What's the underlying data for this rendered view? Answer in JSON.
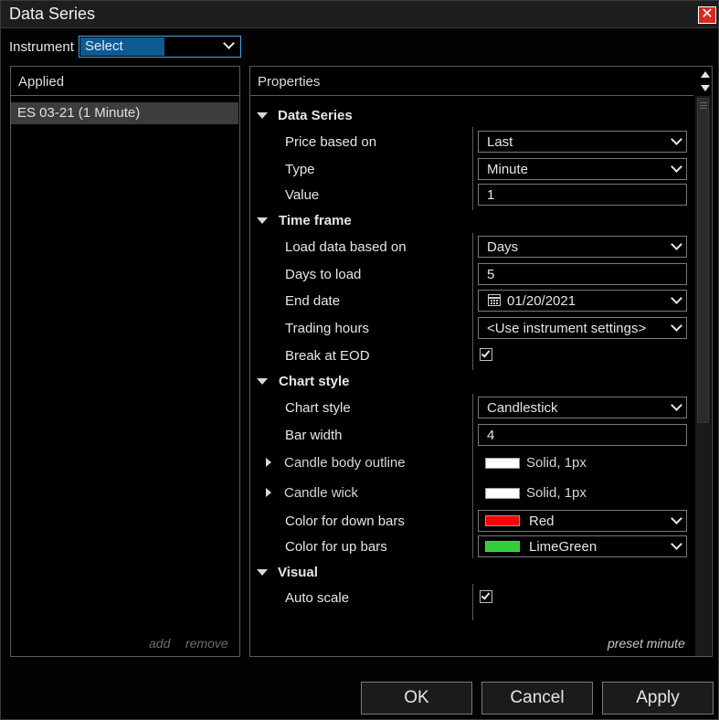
{
  "window": {
    "title": "Data Series"
  },
  "instrument": {
    "label": "Instrument",
    "value": "Select"
  },
  "applied": {
    "header": "Applied",
    "items": [
      "ES 03-21 (1 Minute)"
    ],
    "add": "add",
    "remove": "remove"
  },
  "properties": {
    "header": "Properties",
    "categories": {
      "data_series": "Data Series",
      "time_frame": "Time frame",
      "chart_style": "Chart style",
      "visual": "Visual"
    },
    "rows": {
      "price_based_on": {
        "label": "Price based on",
        "value": "Last"
      },
      "type": {
        "label": "Type",
        "value": "Minute"
      },
      "value": {
        "label": "Value",
        "value": "1"
      },
      "load_data_based_on": {
        "label": "Load data based on",
        "value": "Days"
      },
      "days_to_load": {
        "label": "Days to load",
        "value": "5"
      },
      "end_date": {
        "label": "End date",
        "value": "01/20/2021"
      },
      "trading_hours": {
        "label": "Trading hours",
        "value": "<Use instrument settings>"
      },
      "break_at_eod": {
        "label": "Break at EOD",
        "checked": true
      },
      "chart_style": {
        "label": "Chart style",
        "value": "Candlestick"
      },
      "bar_width": {
        "label": "Bar width",
        "value": "4"
      },
      "candle_body_outline": {
        "label": "Candle body outline",
        "value": "Solid, 1px",
        "color": "#ffffff"
      },
      "candle_wick": {
        "label": "Candle wick",
        "value": "Solid, 1px",
        "color": "#ffffff"
      },
      "color_down": {
        "label": "Color for down bars",
        "value": "Red",
        "color": "#ff0000"
      },
      "color_up": {
        "label": "Color for up bars",
        "value": "LimeGreen",
        "color": "#32cd32"
      },
      "auto_scale": {
        "label": "Auto scale",
        "checked": true
      }
    },
    "preset": "preset minute"
  },
  "buttons": {
    "ok": "OK",
    "cancel": "Cancel",
    "apply": "Apply"
  },
  "colors": {
    "accent": "#4aa3df",
    "selection": "#0e5a94",
    "close": "#d52b1e",
    "background": "#000000"
  }
}
